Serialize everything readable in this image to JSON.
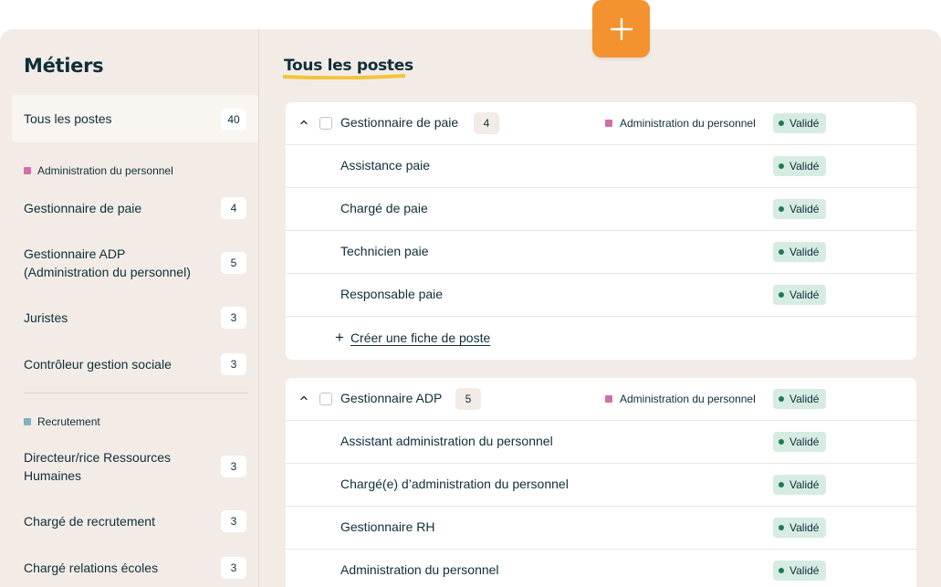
{
  "sidebar": {
    "title": "Métiers",
    "all": {
      "label": "Tous les postes",
      "count": "40"
    },
    "groups": [
      {
        "name": "Administration du personnel",
        "color": "#d16fa9",
        "items": [
          {
            "label": "Gestionnaire de paie",
            "count": "4"
          },
          {
            "label_line1": "Gestionnaire ADP",
            "label_line2": "(Administration du personnel)",
            "count": "5"
          },
          {
            "label": "Juristes",
            "count": "3"
          },
          {
            "label": "Contrôleur gestion sociale",
            "count": "3"
          }
        ]
      },
      {
        "name": "Recrutement",
        "color": "#7fb3c2",
        "items": [
          {
            "label_line1": "Directeur/rice Ressources",
            "label_line2": "Humaines",
            "count": "3"
          },
          {
            "label": "Chargé de recrutement",
            "count": "3"
          },
          {
            "label": "Chargé relations écoles",
            "count": "3"
          }
        ]
      }
    ]
  },
  "main": {
    "title": "Tous les postes",
    "accent": "#f5c33b",
    "status_label": "Validé",
    "create_label": "Créer une fiche de poste",
    "groups": [
      {
        "name": "Gestionnaire de paie",
        "count": "4",
        "category": "Administration du personnel",
        "status": "Validé",
        "items": [
          "Assistance paie",
          "Chargé de paie",
          "Technicien paie",
          "Responsable paie"
        ]
      },
      {
        "name": "Gestionnaire ADP",
        "count": "5",
        "category": "Administration du personnel",
        "status": "Validé",
        "items": [
          "Assistant administration du personnel",
          "Chargé(e) d’administration du personnel",
          "Gestionnaire RH",
          "Administration du personnel"
        ]
      }
    ]
  },
  "fab": {
    "icon": "plus-icon",
    "color": "#f3922f"
  }
}
